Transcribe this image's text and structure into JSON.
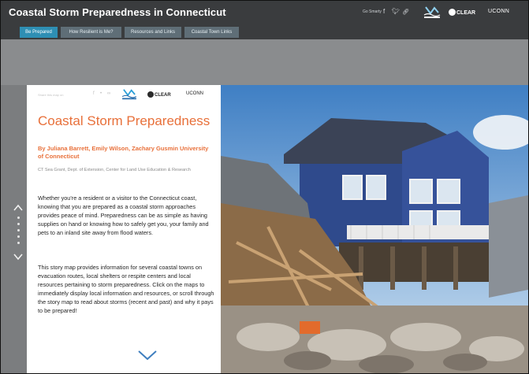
{
  "app": {
    "title": "Coastal Storm Preparedness in Connecticut",
    "share_label": "Go Smarty",
    "social_icons": [
      "facebook-icon",
      "twitter-icon",
      "link-icon"
    ],
    "brands": {
      "sea_grant": "Sea Grant",
      "clear": "CLEAR",
      "uconn": "UCONN"
    }
  },
  "tabs": [
    {
      "label": "Be Prepared",
      "active": true
    },
    {
      "label": "How Resilient is Me?",
      "active": false
    },
    {
      "label": "Resources and Links",
      "active": false
    },
    {
      "label": "Coastal Town Links",
      "active": false
    }
  ],
  "panel": {
    "share_label": "Share this map on",
    "brands": {
      "clear": "CLEAR",
      "uconn": "UCONN"
    },
    "title": "Coastal Storm Preparedness",
    "byline": "By Juliana Barrett, Emily Wilson, Zachary Gusmin University of Connecticut",
    "affiliation": "CT Sea Grant, Dept. of Extension, Center for Land Use Education & Research",
    "paragraph1": "Whether you're a resident or a visitor to the Connecticut coast, knowing that you are prepared as a coastal storm approaches provides peace of mind. Preparedness can be as simple as having supplies on hand or knowing how to safely get you, your family and pets to an inland site away from flood waters.",
    "paragraph2": "This story map provides information for several coastal towns on evacuation routes, local shelters or respite centers and local resources pertaining to storm preparedness. Click on the maps to immediately display local information and resources, or scroll through the story map to read about storms (recent and past) and why it pays to be prepared!"
  },
  "colors": {
    "accent": "#e8703a",
    "tab_active": "#2e8fb4",
    "tab_inactive": "#5f6e77",
    "header_bg": "#3a3c3e"
  }
}
